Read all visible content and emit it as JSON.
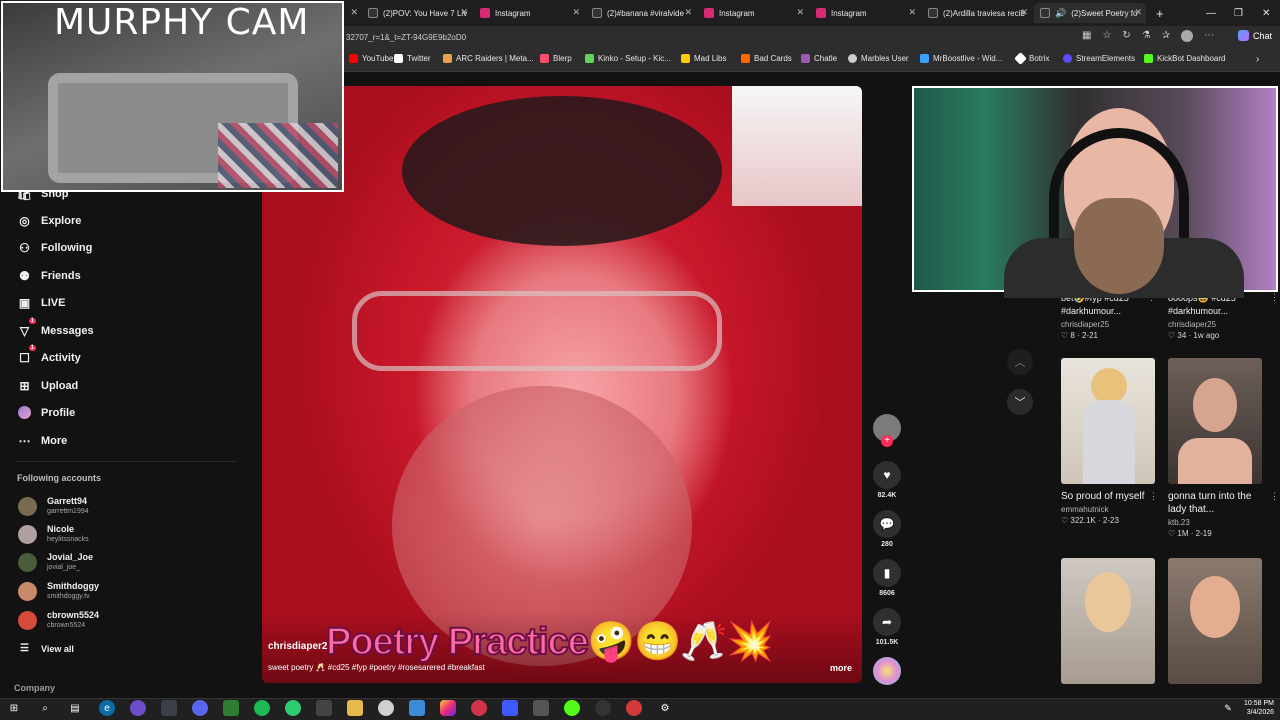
{
  "tabs": [
    {
      "label": "(2)POV: You Have 7 Liv",
      "color": "#e6e6e6"
    },
    {
      "label": "Instagram",
      "color": "#d62976"
    },
    {
      "label": "(2)#banana #viralvide",
      "color": "#e6e6e6"
    },
    {
      "label": "Instagram",
      "color": "#d62976"
    },
    {
      "label": "Instagram",
      "color": "#d62976"
    },
    {
      "label": "(2)Ardilla traviesa recib",
      "color": "#e6e6e6"
    },
    {
      "label": "(2)Sweet Poetry fo",
      "color": "#e6e6e6"
    }
  ],
  "address": "32707_r=1&_t=ZT-94G9E9b2oD0",
  "chat_label": "Chat",
  "bookmarks": [
    {
      "label": "YouTube",
      "color": "#ff0000"
    },
    {
      "label": "Twitter",
      "color": "#ffffff"
    },
    {
      "label": "ARC Raiders | Meta...",
      "color": "#e8a34a"
    },
    {
      "label": "Blerp",
      "color": "#ff4d6d"
    },
    {
      "label": "Kinko - Setup - Kic...",
      "color": "#5cd65c"
    },
    {
      "label": "Mad Libs",
      "color": "#ffcc00"
    },
    {
      "label": "Bad Cards",
      "color": "#ff6600"
    },
    {
      "label": "Chatle",
      "color": "#9b59b6"
    },
    {
      "label": "Marbles User",
      "color": "#cccccc"
    },
    {
      "label": "MrBoostlive - Wid...",
      "color": "#3aa0ff"
    },
    {
      "label": "Botrix",
      "color": "#ffffff"
    },
    {
      "label": "StreamElements",
      "color": "#5b4bff"
    },
    {
      "label": "KickBot Dashboard",
      "color": "#53fc18"
    }
  ],
  "sidebar": {
    "shop_label": "Shop",
    "nav": [
      {
        "label": "Explore",
        "icon": "compass-icon"
      },
      {
        "label": "Following",
        "icon": "user-follow-icon"
      },
      {
        "label": "Friends",
        "icon": "friends-icon"
      },
      {
        "label": "LIVE",
        "icon": "live-icon"
      },
      {
        "label": "Messages",
        "icon": "messages-icon",
        "badge": "1"
      },
      {
        "label": "Activity",
        "icon": "activity-icon",
        "badge": "1"
      },
      {
        "label": "Upload",
        "icon": "upload-icon"
      },
      {
        "label": "Profile",
        "icon": "profile-icon"
      },
      {
        "label": "More",
        "icon": "more-icon"
      }
    ],
    "following_header": "Following accounts",
    "accounts": [
      {
        "name": "Garrett94",
        "handle": "garrettm1994",
        "color": "#7a6a50"
      },
      {
        "name": "Nicole",
        "handle": "heylitssnacks",
        "color": "#b0a0a0"
      },
      {
        "name": "Jovial_Joe",
        "handle": "jovial_joe_",
        "color": "#4a5d3a"
      },
      {
        "name": "Smithdoggy",
        "handle": "smithdoggy.tv",
        "color": "#c98a6a"
      },
      {
        "name": "cbrown5524",
        "handle": "cbrown5524",
        "color": "#d44b3b"
      }
    ],
    "view_all": "View all",
    "company": "Company"
  },
  "video": {
    "overlay_text": "Poetry Practice🤪😁🥂💥",
    "username": "chrisdiaper25",
    "caption": "sweet poetry 🥂 #cd25 #fyp #poetry #rosesarered #breakfast",
    "more": "more",
    "likes": "82.4K",
    "comments": "280",
    "saves": "8606",
    "shares": "101.5K"
  },
  "right_panel": {
    "cards": [
      {
        "title": "bet🤣#fyp #cd25 #darkhumour...",
        "user": "chrisdiaper25",
        "likes": "8",
        "date": "2-21"
      },
      {
        "title": "oooops😆 #cd25 #darkhumour...",
        "user": "chrisdiaper25",
        "likes": "34",
        "date": "1w ago"
      },
      {
        "title": "So proud of myself",
        "user": "emmahutnick",
        "likes": "322.1K",
        "date": "2-23"
      },
      {
        "title": "gonna turn into the lady that...",
        "user": "ktb.23",
        "likes": "1M",
        "date": "2-19"
      }
    ]
  },
  "overlays": {
    "murphy_title": "MURPHY CAM"
  },
  "taskbar": {
    "time": "10:58 PM",
    "date": "3/4/2026"
  }
}
